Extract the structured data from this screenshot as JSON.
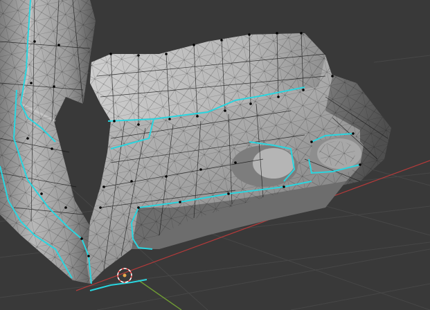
{
  "viewport": {
    "mode": "edit-mode",
    "background_color": "#393939",
    "grid_line_color": "#474747",
    "x_axis_color": "#b43a3a",
    "y_axis_color": "#6f9a34",
    "mesh_shade_light": "#bdbdbd",
    "mesh_shade_mid": "#8c8c8c",
    "mesh_shade_dark": "#5e5e5e",
    "wireframe_color": "#111111",
    "vertex_color": "#000000",
    "seam_color": "#29d6e0",
    "cursor_colors": [
      "#ff5555",
      "#ffffff"
    ]
  }
}
